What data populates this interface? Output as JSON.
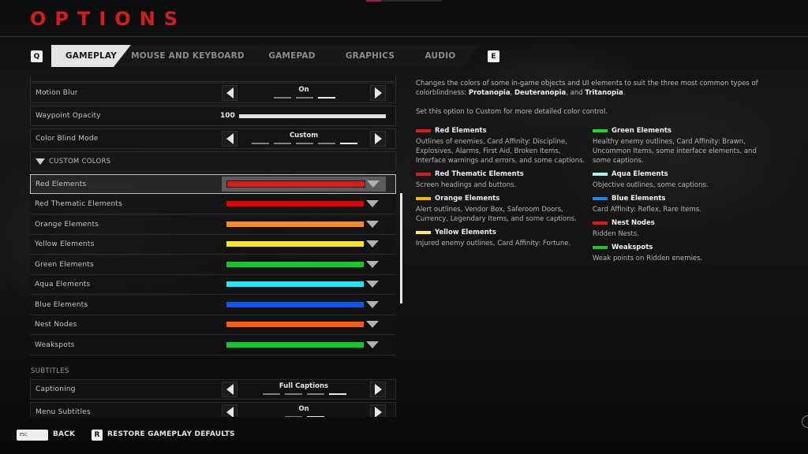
{
  "top_progress": {
    "fraction": 0.2,
    "fill_color": "#a0185c"
  },
  "header": {
    "title": "OPTIONS"
  },
  "tabs": {
    "prev_key": "Q",
    "next_key": "E",
    "items": [
      {
        "label": "GAMEPLAY",
        "active": true
      },
      {
        "label": "MOUSE AND KEYBOARD",
        "active": false
      },
      {
        "label": "GAMEPAD",
        "active": false
      },
      {
        "label": "GRAPHICS",
        "active": false
      },
      {
        "label": "AUDIO",
        "active": false
      }
    ]
  },
  "settings": {
    "motion_blur": {
      "label": "Motion Blur",
      "value": "On",
      "option_count": 3,
      "selected_index": 2
    },
    "waypoint_opacity": {
      "label": "Waypoint Opacity",
      "value": "100",
      "percent": 100
    },
    "color_blind_mode": {
      "label": "Color Blind Mode",
      "value": "Custom",
      "option_count": 5,
      "selected_index": 4
    },
    "custom_colors_header": "CUSTOM COLORS",
    "custom_colors": [
      {
        "label": "Red Elements",
        "color": "#e01b1b",
        "selected": true
      },
      {
        "label": "Red Thematic Elements",
        "color": "#e00000"
      },
      {
        "label": "Orange Elements",
        "color": "#ff8a1c"
      },
      {
        "label": "Yellow Elements",
        "color": "#ffe52a"
      },
      {
        "label": "Green Elements",
        "color": "#0fcb2a"
      },
      {
        "label": "Aqua Elements",
        "color": "#18eaf8"
      },
      {
        "label": "Blue Elements",
        "color": "#0f55f0"
      },
      {
        "label": "Nest Nodes",
        "color": "#ff5a05"
      },
      {
        "label": "Weakspots",
        "color": "#10cc2a"
      }
    ],
    "subtitles_header": "SUBTITLES",
    "captioning": {
      "label": "Captioning",
      "value": "Full Captions",
      "option_count": 4,
      "selected_index": 3
    },
    "menu_subtitles": {
      "label": "Menu Subtitles",
      "value": "On",
      "option_count": 2,
      "selected_index": 1
    }
  },
  "info": {
    "desc_prefix": "Changes the colors of some in-game objects and UI elements to suit the three most common types of colorblindness: ",
    "term1": "Protanopia",
    "sep1": ", ",
    "term2": "Deuteranopia",
    "sep2": ", and ",
    "term3": "Tritanopia",
    "desc_end": ".",
    "hint": "Set this option to Custom for more detailed color control.",
    "legend_left": [
      {
        "title": "Red Elements",
        "color": "#e01b1b",
        "text": "Outlines of enemies, Card Affinity: Discipline, Explosives, Alarms, First Aid, Broken Items, Interface warnings and errors, and some captions."
      },
      {
        "title": "Red Thematic Elements",
        "color": "#d62020",
        "text": "Screen headings and buttons."
      },
      {
        "title": "Orange Elements",
        "color": "#f5b800",
        "text": "Alert outlines, Vendor Box, Saferoom Doors, Currency, Legendary Items, and some captions."
      },
      {
        "title": "Yellow Elements",
        "color": "#f5ee6a",
        "text": "Injured enemy outlines, Card Affinity: Fortune."
      }
    ],
    "legend_right": [
      {
        "title": "Green Elements",
        "color": "#1ad82a",
        "text": "Healthy enemy outlines, Card Affinity: Brawn, Uncommon Items, some interface elements, and some captions."
      },
      {
        "title": "Aqua Elements",
        "color": "#a8f2fa",
        "text": "Objective outlines, some captions."
      },
      {
        "title": "Blue Elements",
        "color": "#1a82e8",
        "text": "Card Affinity: Reflex, Rare Items."
      },
      {
        "title": "Nest Nodes",
        "color": "#e81515",
        "text": "Ridden Nests."
      },
      {
        "title": "Weakspots",
        "color": "#18c22a",
        "text": "Weak points on Ridden enemies."
      }
    ]
  },
  "footer": {
    "esc_key": "ESC",
    "back_label": "BACK",
    "restore_key": "R",
    "restore_label": "RESTORE GAMEPLAY DEFAULTS"
  }
}
